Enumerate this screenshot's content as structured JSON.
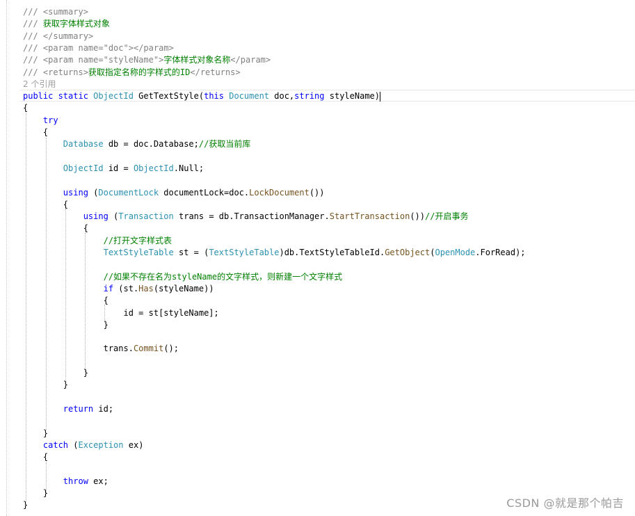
{
  "editor": {
    "lines": [
      {
        "segs": [
          [
            "c-gray",
            "/// <summary>"
          ]
        ]
      },
      {
        "segs": [
          [
            "c-gray",
            "/// "
          ],
          [
            "c-green",
            "获取字体样式对象"
          ]
        ]
      },
      {
        "segs": [
          [
            "c-gray",
            "/// </summary>"
          ]
        ]
      },
      {
        "segs": [
          [
            "c-gray",
            "/// <param name=\""
          ],
          [
            "c-gray",
            "doc"
          ],
          [
            "c-gray",
            "\"></param>"
          ]
        ]
      },
      {
        "segs": [
          [
            "c-gray",
            "/// <param name=\""
          ],
          [
            "c-gray",
            "styleName"
          ],
          [
            "c-gray",
            "\">"
          ],
          [
            "c-green",
            "字体样式对象名称"
          ],
          [
            "c-gray",
            "</param>"
          ]
        ]
      },
      {
        "segs": [
          [
            "c-gray",
            "/// <returns>"
          ],
          [
            "c-green",
            "获取指定名称的字样式的ID"
          ],
          [
            "c-gray",
            "</returns>"
          ]
        ]
      },
      {
        "segs": [
          [
            "c-lens",
            "2 个引用"
          ]
        ]
      },
      {
        "segs": [
          [
            "c-kw",
            "public static "
          ],
          [
            "c-type",
            "ObjectId"
          ],
          [
            "c-text",
            " GetTextStyle("
          ],
          [
            "c-kw",
            "this "
          ],
          [
            "c-type",
            "Document"
          ],
          [
            "c-text",
            " doc,"
          ],
          [
            "c-kw",
            "string"
          ],
          [
            "c-text",
            " styleName)"
          ]
        ],
        "cursor": true
      },
      {
        "segs": [
          [
            "c-text",
            "{"
          ]
        ]
      },
      {
        "segs": [
          [
            "c-kw",
            "    try"
          ]
        ]
      },
      {
        "segs": [
          [
            "c-text",
            "    {"
          ]
        ]
      },
      {
        "segs": [
          [
            "c-type",
            "        Database"
          ],
          [
            "c-text",
            " db = doc.Database;"
          ],
          [
            "c-green",
            "//获取当前库"
          ]
        ]
      },
      {
        "segs": [
          [
            "c-text",
            ""
          ]
        ]
      },
      {
        "segs": [
          [
            "c-type",
            "        ObjectId"
          ],
          [
            "c-text",
            " id = "
          ],
          [
            "c-type",
            "ObjectId"
          ],
          [
            "c-text",
            ".Null;"
          ]
        ]
      },
      {
        "segs": [
          [
            "c-text",
            ""
          ]
        ]
      },
      {
        "segs": [
          [
            "c-kw",
            "        using"
          ],
          [
            "c-text",
            " ("
          ],
          [
            "c-type",
            "DocumentLock"
          ],
          [
            "c-text",
            " documentLock=doc."
          ],
          [
            "c-method",
            "LockDocument"
          ],
          [
            "c-text",
            "())"
          ]
        ]
      },
      {
        "segs": [
          [
            "c-text",
            "        {"
          ]
        ]
      },
      {
        "segs": [
          [
            "c-kw",
            "            using"
          ],
          [
            "c-text",
            " ("
          ],
          [
            "c-type",
            "Transaction"
          ],
          [
            "c-text",
            " trans = db.TransactionManager."
          ],
          [
            "c-method",
            "StartTransaction"
          ],
          [
            "c-text",
            "())"
          ],
          [
            "c-green",
            "//开启事务"
          ]
        ]
      },
      {
        "segs": [
          [
            "c-text",
            "            {"
          ]
        ]
      },
      {
        "segs": [
          [
            "c-green",
            "                //打开文字样式表"
          ]
        ]
      },
      {
        "segs": [
          [
            "c-type",
            "                TextStyleTable"
          ],
          [
            "c-text",
            " st = ("
          ],
          [
            "c-type",
            "TextStyleTable"
          ],
          [
            "c-text",
            ")db.TextStyleTableId."
          ],
          [
            "c-method",
            "GetObject"
          ],
          [
            "c-text",
            "("
          ],
          [
            "c-type",
            "OpenMode"
          ],
          [
            "c-text",
            ".ForRead);"
          ]
        ]
      },
      {
        "segs": [
          [
            "c-text",
            ""
          ]
        ]
      },
      {
        "segs": [
          [
            "c-green",
            "                //如果不存在名为styleName的文字样式，则新建一个文字样式"
          ]
        ]
      },
      {
        "segs": [
          [
            "c-kw",
            "                if"
          ],
          [
            "c-text",
            " (st."
          ],
          [
            "c-method",
            "Has"
          ],
          [
            "c-text",
            "(styleName))"
          ]
        ]
      },
      {
        "segs": [
          [
            "c-text",
            "                {"
          ]
        ]
      },
      {
        "segs": [
          [
            "c-text",
            "                    id = st[styleName];"
          ]
        ]
      },
      {
        "segs": [
          [
            "c-text",
            "                }"
          ]
        ]
      },
      {
        "segs": [
          [
            "c-text",
            ""
          ]
        ]
      },
      {
        "segs": [
          [
            "c-text",
            "                trans."
          ],
          [
            "c-method",
            "Commit"
          ],
          [
            "c-text",
            "();"
          ]
        ]
      },
      {
        "segs": [
          [
            "c-text",
            ""
          ]
        ]
      },
      {
        "segs": [
          [
            "c-text",
            "            }"
          ]
        ]
      },
      {
        "segs": [
          [
            "c-text",
            "        }"
          ]
        ]
      },
      {
        "segs": [
          [
            "c-text",
            ""
          ]
        ]
      },
      {
        "segs": [
          [
            "c-kw",
            "        return"
          ],
          [
            "c-text",
            " id;"
          ]
        ]
      },
      {
        "segs": [
          [
            "c-text",
            ""
          ]
        ]
      },
      {
        "segs": [
          [
            "c-text",
            "    }"
          ]
        ]
      },
      {
        "segs": [
          [
            "c-kw",
            "    catch"
          ],
          [
            "c-text",
            " ("
          ],
          [
            "c-type",
            "Exception"
          ],
          [
            "c-text",
            " ex)"
          ]
        ]
      },
      {
        "segs": [
          [
            "c-text",
            "    {"
          ]
        ]
      },
      {
        "segs": [
          [
            "c-text",
            ""
          ]
        ]
      },
      {
        "segs": [
          [
            "c-kw",
            "        throw"
          ],
          [
            "c-text",
            " ex;"
          ]
        ]
      },
      {
        "segs": [
          [
            "c-text",
            "    }"
          ]
        ]
      },
      {
        "segs": [
          [
            "c-text",
            "}"
          ]
        ]
      }
    ]
  },
  "watermark": "CSDN @就是那个帕吉"
}
